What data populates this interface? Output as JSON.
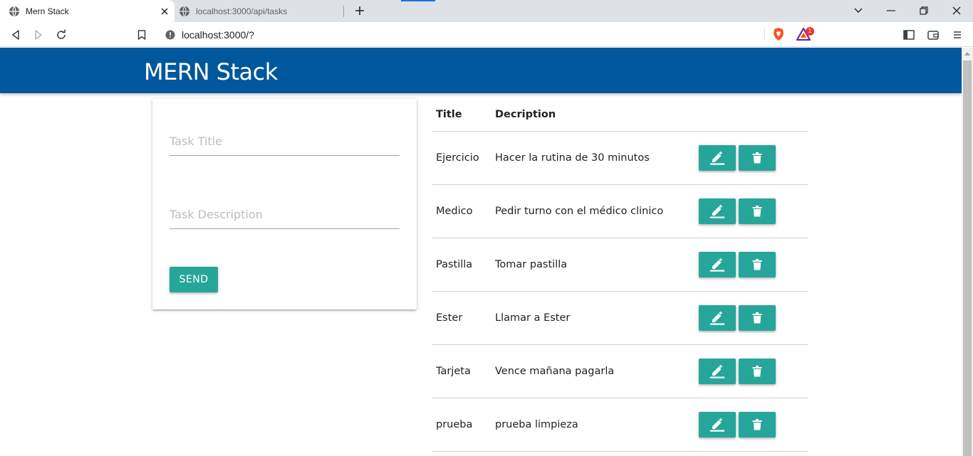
{
  "browser": {
    "tabs": [
      {
        "label": "Mern Stack",
        "active": true
      },
      {
        "label": "localhost:3000/api/tasks",
        "active": false
      }
    ],
    "address": "localhost:3000/?",
    "rewards_badge": "1"
  },
  "app": {
    "brand": "MERN Stack",
    "form": {
      "title_placeholder": "Task Title",
      "description_placeholder": "Task Description",
      "send_label": "SEND"
    },
    "table": {
      "headers": {
        "title": "Title",
        "description": "Decription"
      },
      "rows": [
        {
          "title": "Ejercicio",
          "description": "Hacer la rutina de 30 minutos"
        },
        {
          "title": "Medico",
          "description": "Pedir turno con el médico clinico"
        },
        {
          "title": "Pastilla",
          "description": "Tomar pastilla"
        },
        {
          "title": "Ester",
          "description": "Llamar a Ester"
        },
        {
          "title": "Tarjeta",
          "description": "Vence mañana pagarla"
        },
        {
          "title": "prueba",
          "description": "prueba limpieza"
        }
      ],
      "action_icons": {
        "edit": "edit-icon",
        "delete": "delete-icon"
      }
    }
  },
  "colors": {
    "navbar": "#01579b",
    "button": "#26a69a"
  }
}
